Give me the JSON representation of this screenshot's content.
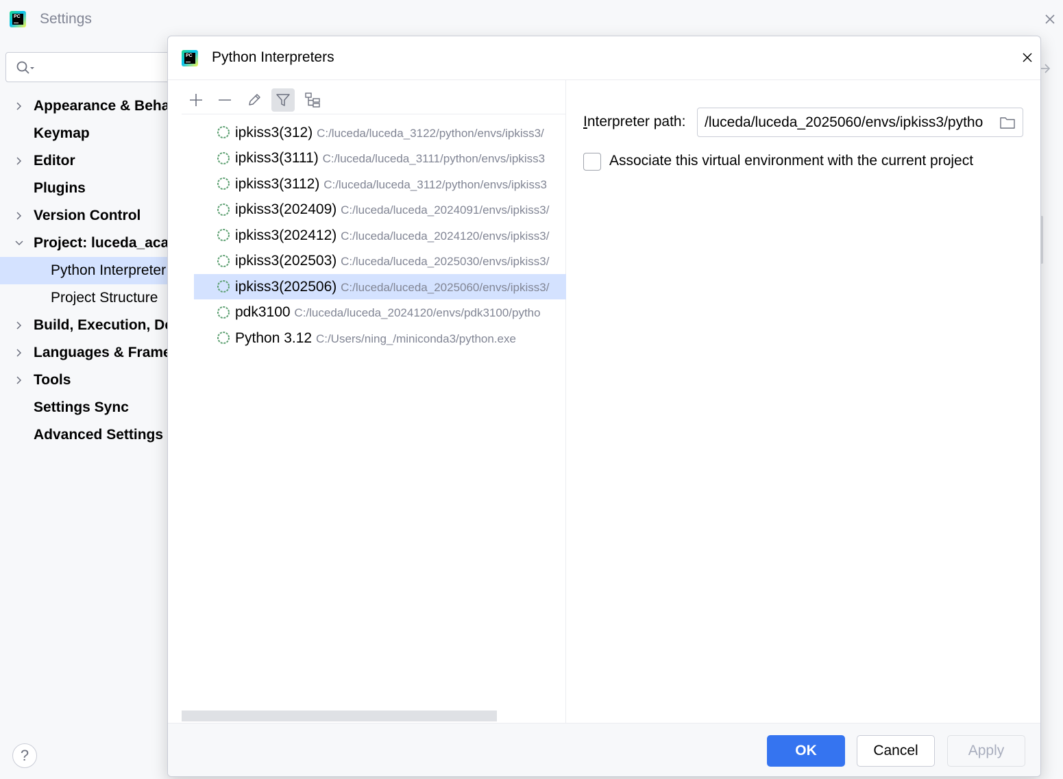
{
  "settings_window": {
    "title": "Settings",
    "search": {
      "placeholder": ""
    },
    "tree": [
      {
        "label": "Appearance & Behavior",
        "expandable": true,
        "level": 0
      },
      {
        "label": "Keymap",
        "expandable": false,
        "level": 0
      },
      {
        "label": "Editor",
        "expandable": true,
        "level": 0
      },
      {
        "label": "Plugins",
        "expandable": false,
        "level": 0
      },
      {
        "label": "Version Control",
        "expandable": true,
        "level": 0
      },
      {
        "label": "Project: luceda_academy",
        "expandable": true,
        "expanded": true,
        "level": 0
      },
      {
        "label": "Python Interpreter",
        "level": 1,
        "selected": true
      },
      {
        "label": "Project Structure",
        "level": 1
      },
      {
        "label": "Build, Execution, Deployment",
        "expandable": true,
        "level": 0
      },
      {
        "label": "Languages & Frameworks",
        "expandable": true,
        "level": 0
      },
      {
        "label": "Tools",
        "expandable": true,
        "level": 0
      },
      {
        "label": "Settings Sync",
        "expandable": false,
        "level": 0
      },
      {
        "label": "Advanced Settings",
        "expandable": false,
        "level": 0
      }
    ],
    "help_label": "?"
  },
  "dialog": {
    "title": "Python Interpreters",
    "toolbar": {
      "add_icon": "plus-icon",
      "remove_icon": "minus-icon",
      "edit_icon": "pencil-icon",
      "filter_icon": "filter-icon",
      "tree_icon": "show-paths-icon"
    },
    "interpreters": [
      {
        "name": "ipkiss3(312)",
        "path": "C:/luceda/luceda_3122/python/envs/ipkiss3/",
        "selected": false
      },
      {
        "name": "ipkiss3(3111)",
        "path": "C:/luceda/luceda_3111/python/envs/ipkiss3",
        "selected": false
      },
      {
        "name": "ipkiss3(3112)",
        "path": "C:/luceda/luceda_3112/python/envs/ipkiss3",
        "selected": false
      },
      {
        "name": "ipkiss3(202409)",
        "path": "C:/luceda/luceda_2024091/envs/ipkiss3/",
        "selected": false
      },
      {
        "name": "ipkiss3(202412)",
        "path": "C:/luceda/luceda_2024120/envs/ipkiss3/",
        "selected": false
      },
      {
        "name": "ipkiss3(202503)",
        "path": "C:/luceda/luceda_2025030/envs/ipkiss3/",
        "selected": false
      },
      {
        "name": "ipkiss3(202506)",
        "path": "C:/luceda/luceda_2025060/envs/ipkiss3/",
        "selected": true
      },
      {
        "name": "pdk3100",
        "path": "C:/luceda/luceda_2024120/envs/pdk3100/pytho",
        "selected": false
      },
      {
        "name": "Python 3.12",
        "path": "C:/Users/ning_/miniconda3/python.exe",
        "selected": false
      }
    ],
    "details": {
      "interpreter_path_label_mnemonic": "I",
      "interpreter_path_label_rest": "nterpreter path:",
      "interpreter_path_value": "/luceda/luceda_2025060/envs/ipkiss3/pytho",
      "associate_label": "Associate this virtual environment with the current project",
      "associate_checked": false
    },
    "buttons": {
      "ok": "OK",
      "cancel": "Cancel",
      "apply": "Apply"
    }
  },
  "colors": {
    "accent": "#3574f0",
    "selection": "#d4e2ff",
    "interpreter_ring": "#5a9e6f",
    "muted_text": "#818594"
  }
}
